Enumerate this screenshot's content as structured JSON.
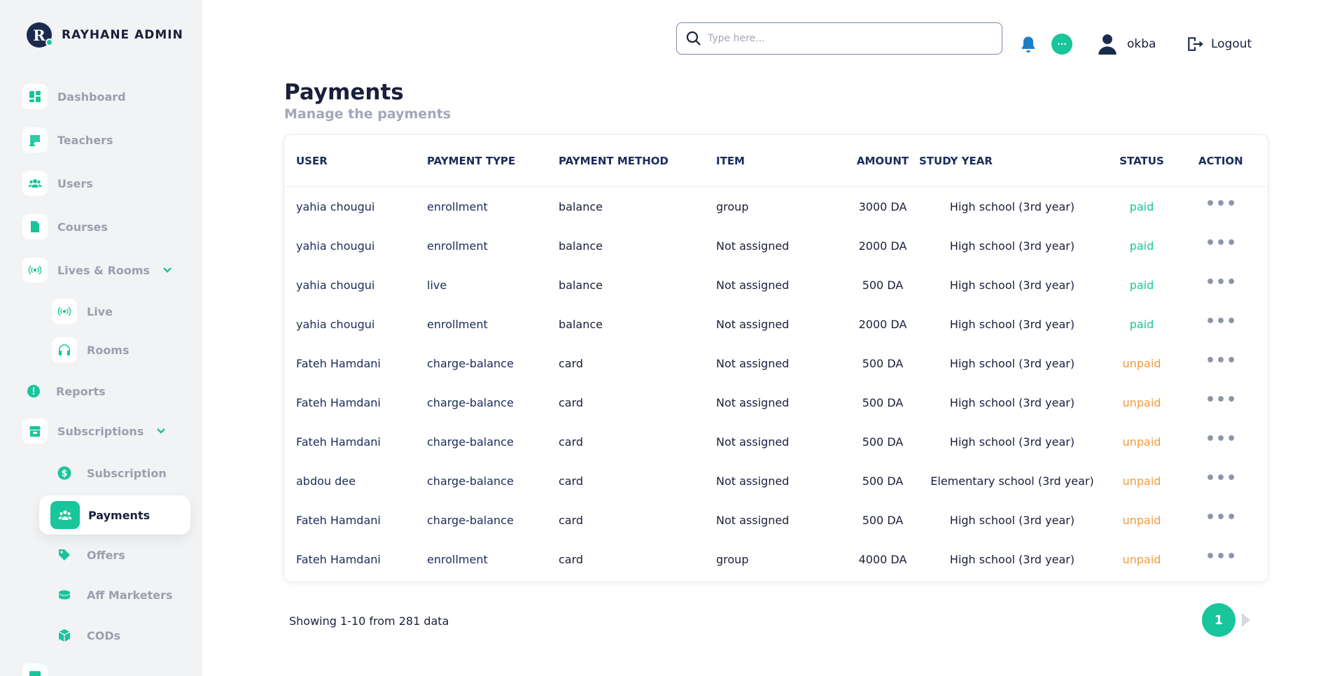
{
  "brand": {
    "logo_letter": "R",
    "name": "RAYHANE ADMIN"
  },
  "sidebar": {
    "items": [
      {
        "label": "Dashboard",
        "icon": "dashboard-icon"
      },
      {
        "label": "Teachers",
        "icon": "teacher-board-icon"
      },
      {
        "label": "Users",
        "icon": "users-icon"
      },
      {
        "label": "Courses",
        "icon": "document-icon"
      },
      {
        "label": "Lives & Rooms",
        "icon": "broadcast-icon",
        "expanded": true
      },
      {
        "label": "Live",
        "icon": "broadcast-icon"
      },
      {
        "label": "Rooms",
        "icon": "headphones-icon"
      },
      {
        "label": "Reports",
        "icon": "alert-icon"
      },
      {
        "label": "Subscriptions",
        "icon": "store-icon",
        "expanded": true
      },
      {
        "label": "Subscription",
        "icon": "dollar-icon"
      },
      {
        "label": "Payments",
        "icon": "group-icon",
        "active": true
      },
      {
        "label": "Offers",
        "icon": "tag-icon"
      },
      {
        "label": "Aff Marketers",
        "icon": "marketer-icon"
      },
      {
        "label": "CODs",
        "icon": "box-icon"
      }
    ]
  },
  "topbar": {
    "search_placeholder": "Type here...",
    "chat_badge": "···",
    "username": "okba",
    "logout_label": "Logout"
  },
  "page": {
    "title": "Payments",
    "subtitle": "Manage the payments"
  },
  "table": {
    "columns": [
      "USER",
      "PAYMENT TYPE",
      "PAYMENT METHOD",
      "ITEM",
      "AMOUNT",
      "STUDY YEAR",
      "STATUS",
      "ACTION"
    ],
    "action_label": "•••",
    "rows": [
      {
        "user": "yahia chougui",
        "type": "enrollment",
        "method": "balance",
        "item": "group",
        "amount": "3000 DA",
        "year": "High school (3rd year)",
        "status": "paid"
      },
      {
        "user": "yahia chougui",
        "type": "enrollment",
        "method": "balance",
        "item": "Not assigned",
        "amount": "2000 DA",
        "year": "High school (3rd year)",
        "status": "paid"
      },
      {
        "user": "yahia chougui",
        "type": "live",
        "method": "balance",
        "item": "Not assigned",
        "amount": "500 DA",
        "year": "High school (3rd year)",
        "status": "paid"
      },
      {
        "user": "yahia chougui",
        "type": "enrollment",
        "method": "balance",
        "item": "Not assigned",
        "amount": "2000 DA",
        "year": "High school (3rd year)",
        "status": "paid"
      },
      {
        "user": "Fateh Hamdani",
        "type": "charge-balance",
        "method": "card",
        "item": "Not assigned",
        "amount": "500 DA",
        "year": "High school (3rd year)",
        "status": "unpaid"
      },
      {
        "user": "Fateh Hamdani",
        "type": "charge-balance",
        "method": "card",
        "item": "Not assigned",
        "amount": "500 DA",
        "year": "High school (3rd year)",
        "status": "unpaid"
      },
      {
        "user": "Fateh Hamdani",
        "type": "charge-balance",
        "method": "card",
        "item": "Not assigned",
        "amount": "500 DA",
        "year": "High school (3rd year)",
        "status": "unpaid"
      },
      {
        "user": "abdou dee",
        "type": "charge-balance",
        "method": "card",
        "item": "Not assigned",
        "amount": "500 DA",
        "year": "Elementary school (3rd year)",
        "status": "unpaid"
      },
      {
        "user": "Fateh Hamdani",
        "type": "charge-balance",
        "method": "card",
        "item": "Not assigned",
        "amount": "500 DA",
        "year": "High school (3rd year)",
        "status": "unpaid"
      },
      {
        "user": "Fateh Hamdani",
        "type": "enrollment",
        "method": "card",
        "item": "group",
        "amount": "4000 DA",
        "year": "High school (3rd year)",
        "status": "unpaid"
      }
    ]
  },
  "pagination": {
    "showing_text": "Showing 1-10 from 281 data",
    "current_page": "1"
  },
  "colors": {
    "accent": "#19c59b",
    "unpaid": "#f29a3c",
    "navy": "#1a2c5b",
    "bell": "#1b7fc6"
  }
}
